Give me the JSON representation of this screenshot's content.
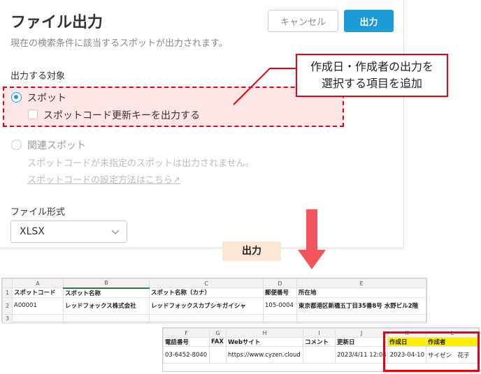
{
  "dialog": {
    "title": "ファイル出力",
    "subtitle": "現在の検索条件に該当するスポットが出力されます。",
    "cancel_label": "キャンセル",
    "output_label": "出力",
    "target_label": "出力する対象",
    "option_spot": "スポット",
    "option_spot_checkbox": "スポットコード更新キーを出力する",
    "option_related": "関連スポット",
    "related_note": "スポットコードが未指定のスポットは出力されません。",
    "related_link": "スポットコードの設定方法はこちら↗",
    "format_label": "ファイル形式",
    "format_value": "XLSX"
  },
  "callout": {
    "line1": "作成日・作成者の出力を",
    "line2": "選択する項目を追加"
  },
  "output_tag": "出力",
  "sheet1": {
    "columns": [
      "",
      "A",
      "B",
      "C",
      "D",
      "E"
    ],
    "rows": [
      {
        "num": "1",
        "cells": [
          "スポットコード",
          "スポット名称",
          "スポット名称（カナ）",
          "郵便番号",
          "所在地"
        ]
      },
      {
        "num": "2",
        "cells": [
          "A00001",
          "レッドフォックス株式会社",
          "レッドフォックスカブシキガイシャ",
          "105-0004",
          "東京都港区新橋五丁目35番8号 水野ビル2階"
        ]
      },
      {
        "num": "3",
        "cells": [
          "",
          "",
          "",
          "",
          ""
        ]
      }
    ]
  },
  "sheet2": {
    "columns": [
      "F",
      "G",
      "H",
      "I",
      "J",
      "K",
      "L"
    ],
    "header_row": [
      "電話番号",
      "FAX",
      "Webサイト",
      "コメント",
      "更新日",
      "作成日",
      "作成者"
    ],
    "data_row": [
      "03-6452-8040",
      "",
      "https://www.cyzen.cloud",
      "",
      "2023/4/11 12:04",
      "2023-04-10",
      "サイゼン　花子"
    ]
  },
  "colors": {
    "accent": "#1b9bd7",
    "highlight_red": "#e60012",
    "highlight_yellow": "#ffee00"
  }
}
